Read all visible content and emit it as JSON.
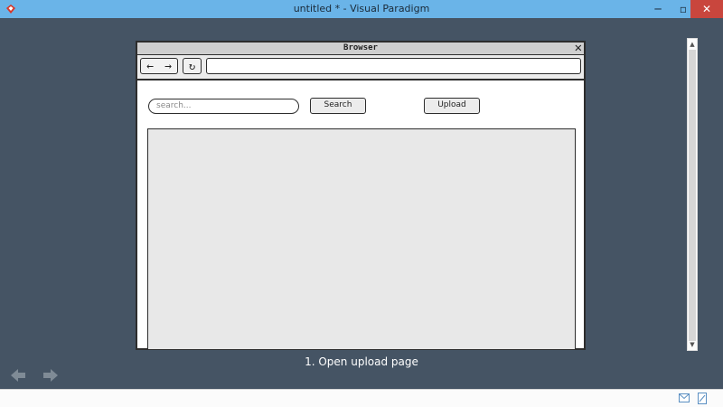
{
  "window": {
    "title": "untitled * - Visual Paradigm",
    "minimize": "─",
    "maximize": "▫",
    "close": "✕"
  },
  "mockup": {
    "browser_title": "Browser",
    "close_glyph": "✕",
    "back_glyph": "←",
    "forward_glyph": "→",
    "refresh_glyph": "↻",
    "address": "",
    "search_placeholder": "search...",
    "search_button": "Search",
    "upload_button": "Upload"
  },
  "caption": "1. Open upload page",
  "nav": {
    "prev_glyph": "🡸",
    "next_glyph": "🡺"
  },
  "scrollbar": {
    "up": "▲",
    "down": "▼"
  },
  "colors": {
    "titlebar": "#6ab4e8",
    "canvas": "#455464",
    "close_button": "#c9463d"
  }
}
